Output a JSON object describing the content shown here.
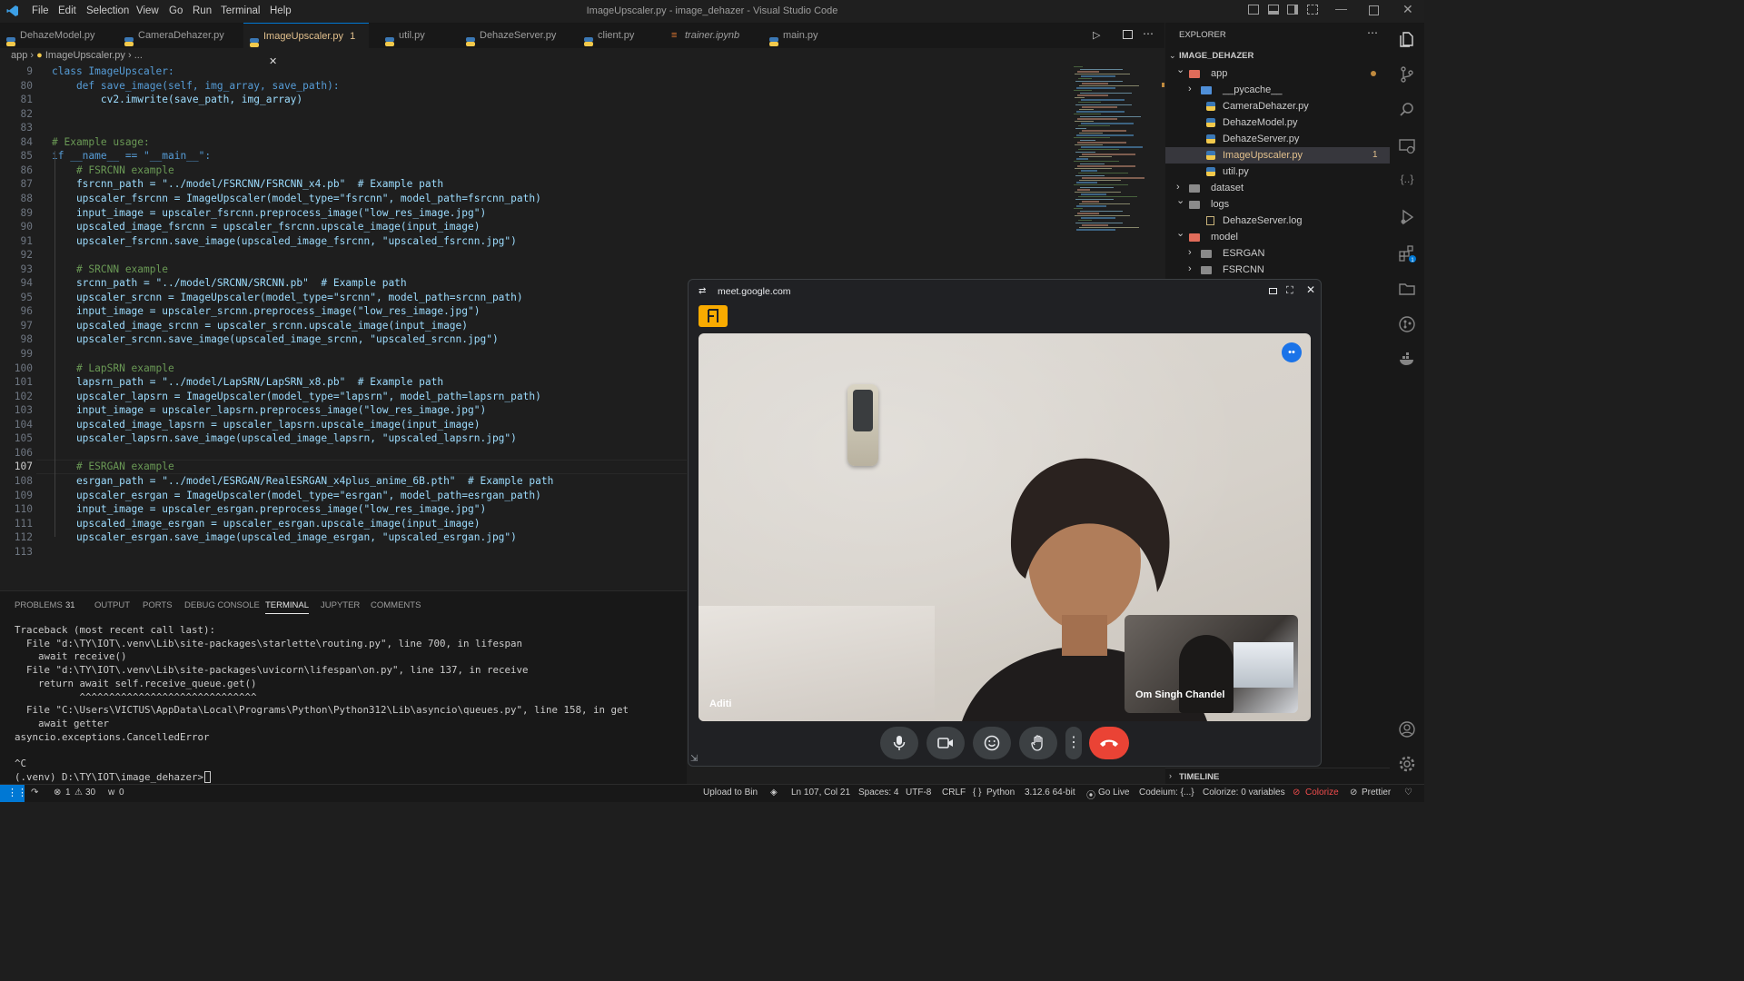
{
  "titlebar": {
    "menu": [
      "File",
      "Edit",
      "Selection",
      "View",
      "Go",
      "Run",
      "Terminal",
      "Help"
    ],
    "title": "ImageUpscaler.py - image_dehazer - Visual Studio Code"
  },
  "tabs": [
    {
      "label": "DehazeModel.py",
      "icon": "python-file-icon",
      "active": false
    },
    {
      "label": "CameraDehazer.py",
      "icon": "python-file-icon",
      "active": false
    },
    {
      "label": "ImageUpscaler.py",
      "badge": "1",
      "icon": "python-file-icon",
      "active": true
    },
    {
      "label": "util.py",
      "icon": "python-file-icon",
      "active": false
    },
    {
      "label": "DehazeServer.py",
      "icon": "python-file-icon",
      "active": false
    },
    {
      "label": "client.py",
      "icon": "python-file-icon",
      "active": false
    },
    {
      "label": "trainer.ipynb",
      "icon": "notebook-icon",
      "active": false
    },
    {
      "label": "main.py",
      "icon": "python-file-icon",
      "active": false
    }
  ],
  "breadcrumb": {
    "folder": "app",
    "file": "ImageUpscaler.py",
    "tail": "..."
  },
  "editor": {
    "current_line": "107",
    "lines": [
      {
        "n": "9",
        "t": "class ImageUpscaler:"
      },
      {
        "n": "80",
        "t": "    def save_image(self, img_array, save_path):"
      },
      {
        "n": "81",
        "t": "        cv2.imwrite(save_path, img_array)"
      },
      {
        "n": "82",
        "t": ""
      },
      {
        "n": "83",
        "t": ""
      },
      {
        "n": "84",
        "t": "# Example usage:"
      },
      {
        "n": "85",
        "t": "if __name__ == \"__main__\":"
      },
      {
        "n": "86",
        "t": "    # FSRCNN example"
      },
      {
        "n": "87",
        "t": "    fsrcnn_path = \"../model/FSRCNN/FSRCNN_x4.pb\"  # Example path"
      },
      {
        "n": "88",
        "t": "    upscaler_fsrcnn = ImageUpscaler(model_type=\"fsrcnn\", model_path=fsrcnn_path)"
      },
      {
        "n": "89",
        "t": "    input_image = upscaler_fsrcnn.preprocess_image(\"low_res_image.jpg\")"
      },
      {
        "n": "90",
        "t": "    upscaled_image_fsrcnn = upscaler_fsrcnn.upscale_image(input_image)"
      },
      {
        "n": "91",
        "t": "    upscaler_fsrcnn.save_image(upscaled_image_fsrcnn, \"upscaled_fsrcnn.jpg\")"
      },
      {
        "n": "92",
        "t": ""
      },
      {
        "n": "93",
        "t": "    # SRCNN example"
      },
      {
        "n": "94",
        "t": "    srcnn_path = \"../model/SRCNN/SRCNN.pb\"  # Example path"
      },
      {
        "n": "95",
        "t": "    upscaler_srcnn = ImageUpscaler(model_type=\"srcnn\", model_path=srcnn_path)"
      },
      {
        "n": "96",
        "t": "    input_image = upscaler_srcnn.preprocess_image(\"low_res_image.jpg\")"
      },
      {
        "n": "97",
        "t": "    upscaled_image_srcnn = upscaler_srcnn.upscale_image(input_image)"
      },
      {
        "n": "98",
        "t": "    upscaler_srcnn.save_image(upscaled_image_srcnn, \"upscaled_srcnn.jpg\")"
      },
      {
        "n": "99",
        "t": ""
      },
      {
        "n": "100",
        "t": "    # LapSRN example"
      },
      {
        "n": "101",
        "t": "    lapsrn_path = \"../model/LapSRN/LapSRN_x8.pb\"  # Example path"
      },
      {
        "n": "102",
        "t": "    upscaler_lapsrn = ImageUpscaler(model_type=\"lapsrn\", model_path=lapsrn_path)"
      },
      {
        "n": "103",
        "t": "    input_image = upscaler_lapsrn.preprocess_image(\"low_res_image.jpg\")"
      },
      {
        "n": "104",
        "t": "    upscaled_image_lapsrn = upscaler_lapsrn.upscale_image(input_image)"
      },
      {
        "n": "105",
        "t": "    upscaler_lapsrn.save_image(upscaled_image_lapsrn, \"upscaled_lapsrn.jpg\")"
      },
      {
        "n": "106",
        "t": ""
      },
      {
        "n": "107",
        "t": "    # ESRGAN example"
      },
      {
        "n": "108",
        "t": "    esrgan_path = \"../model/ESRGAN/RealESRGAN_x4plus_anime_6B.pth\"  # Example path"
      },
      {
        "n": "109",
        "t": "    upscaler_esrgan = ImageUpscaler(model_type=\"esrgan\", model_path=esrgan_path)"
      },
      {
        "n": "110",
        "t": "    input_image = upscaler_esrgan.preprocess_image(\"low_res_image.jpg\")"
      },
      {
        "n": "111",
        "t": "    upscaled_image_esrgan = upscaler_esrgan.upscale_image(input_image)"
      },
      {
        "n": "112",
        "t": "    upscaler_esrgan.save_image(upscaled_image_esrgan, \"upscaled_esrgan.jpg\")"
      },
      {
        "n": "113",
        "t": ""
      }
    ]
  },
  "panel": {
    "tabs": [
      "PROBLEMS",
      "OUTPUT",
      "PORTS",
      "DEBUG CONSOLE",
      "TERMINAL",
      "JUPYTER",
      "COMMENTS"
    ],
    "problems_count": "31",
    "active_tab": "TERMINAL",
    "terminal_lines": [
      "Traceback (most recent call last):",
      "  File \"d:\\TY\\IOT\\.venv\\Lib\\site-packages\\starlette\\routing.py\", line 700, in lifespan",
      "    await receive()",
      "  File \"d:\\TY\\IOT\\.venv\\Lib\\site-packages\\uvicorn\\lifespan\\on.py\", line 137, in receive",
      "    return await self.receive_queue.get()",
      "           ^^^^^^^^^^^^^^^^^^^^^^^^^^^^^^",
      "  File \"C:\\Users\\VICTUS\\AppData\\Local\\Programs\\Python\\Python312\\Lib\\asyncio\\queues.py\", line 158, in get",
      "    await getter",
      "asyncio.exceptions.CancelledError",
      "",
      "^C",
      "(.venv) D:\\TY\\IOT\\image_dehazer>"
    ]
  },
  "explorer": {
    "header": "EXPLORER",
    "project": "IMAGE_DEHAZER",
    "tree": [
      {
        "label": "app",
        "depth": 0,
        "kind": "folder-open",
        "color": "#e06c5a"
      },
      {
        "label": "__pycache__",
        "depth": 1,
        "kind": "folder-closed",
        "color": "#4f8fd8"
      },
      {
        "label": "CameraDehazer.py",
        "depth": 1,
        "kind": "py"
      },
      {
        "label": "DehazeModel.py",
        "depth": 1,
        "kind": "py"
      },
      {
        "label": "DehazeServer.py",
        "depth": 1,
        "kind": "py"
      },
      {
        "label": "ImageUpscaler.py",
        "depth": 1,
        "kind": "py",
        "selected": true,
        "badge": "1"
      },
      {
        "label": "util.py",
        "depth": 1,
        "kind": "py"
      },
      {
        "label": "dataset",
        "depth": 0,
        "kind": "folder-closed",
        "color": "#8a8a8a"
      },
      {
        "label": "logs",
        "depth": 0,
        "kind": "folder-open",
        "color": "#8a8a8a"
      },
      {
        "label": "DehazeServer.log",
        "depth": 1,
        "kind": "log"
      },
      {
        "label": "model",
        "depth": 0,
        "kind": "folder-open",
        "color": "#e06c5a"
      },
      {
        "label": "ESRGAN",
        "depth": 1,
        "kind": "folder-closed",
        "color": "#8a8a8a"
      },
      {
        "label": "FSRCNN",
        "depth": 1,
        "kind": "folder-closed",
        "color": "#8a8a8a"
      }
    ],
    "timeline": "TIMELINE"
  },
  "meet": {
    "url": "meet.google.com",
    "main_participant": "Aditi",
    "self_participant": "Om Singh Chandel",
    "controls": [
      "microphone-icon",
      "camera-icon",
      "emoji-icon",
      "raise-hand-icon",
      "more-options-icon",
      "end-call-icon"
    ]
  },
  "status": {
    "errors": "1",
    "warnings": "30",
    "ports": "0",
    "upload": "Upload to Bin",
    "position": "Ln 107, Col 21",
    "spaces": "Spaces: 4",
    "encoding": "UTF-8",
    "eol": "CRLF",
    "language": "Python",
    "interpreter": "3.12.6 64-bit",
    "golive": "Go Live",
    "codeium": "Codeium: {...}",
    "colorize_vars": "Colorize: 0 variables",
    "colorize": "Colorize",
    "prettier": "Prettier"
  },
  "colors": {
    "accent": "#0078d4",
    "end_call": "#ea4335",
    "selected_file": "#e2c08d"
  }
}
